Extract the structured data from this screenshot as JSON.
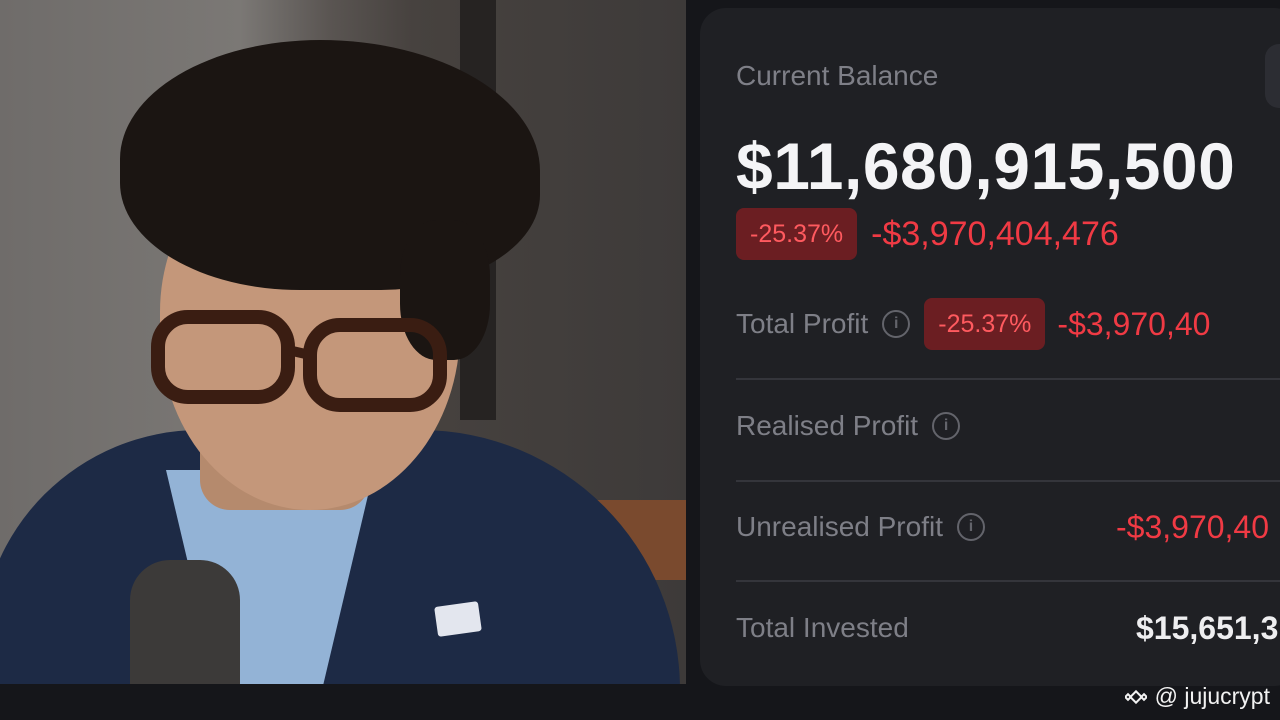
{
  "balance": {
    "label": "Current Balance",
    "value": "$11,680,915,500",
    "change_pct": "-25.37%",
    "change_value": "-$3,970,404,476"
  },
  "rows": {
    "total_profit": {
      "label": "Total Profit",
      "pct": "-25.37%",
      "value": "-$3,970,40"
    },
    "realised_profit": {
      "label": "Realised Profit"
    },
    "unrealised_profit": {
      "label": "Unrealised Profit",
      "value": "-$3,970,40"
    },
    "total_invested": {
      "label": "Total Invested",
      "value": "$15,651,3"
    }
  },
  "watermark": {
    "text": "@ jujucrypt",
    "icon": "binance-icon"
  },
  "colors": {
    "negative": "#f03a44",
    "badge_bg": "#6b1e22",
    "card_bg": "#1f2024"
  }
}
